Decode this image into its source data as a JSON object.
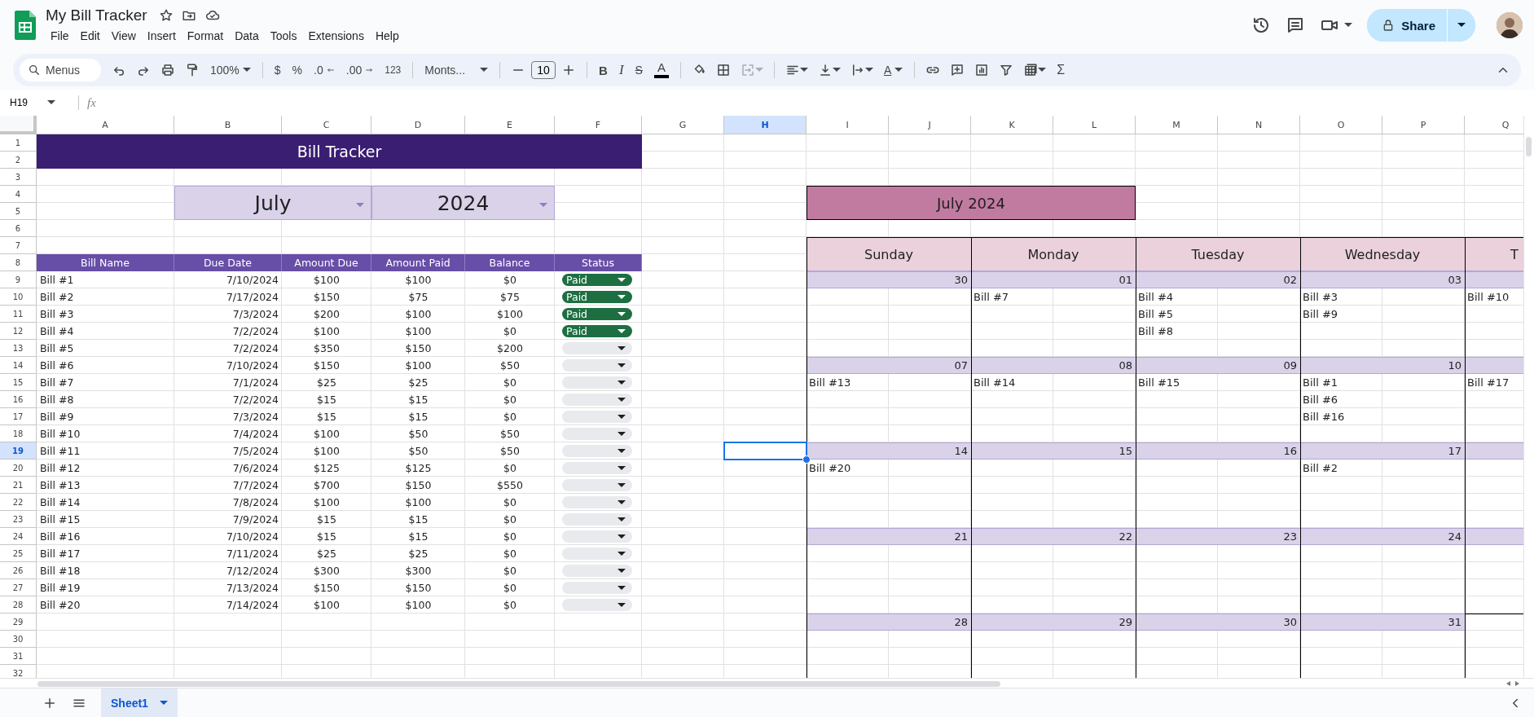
{
  "header": {
    "title": "My Bill Tracker",
    "menus": [
      "File",
      "Edit",
      "View",
      "Insert",
      "Format",
      "Data",
      "Tools",
      "Extensions",
      "Help"
    ],
    "share": "Share"
  },
  "toolbar": {
    "search_placeholder": "Menus",
    "zoom": "100%",
    "currency": "$",
    "percent": "%",
    "decrease_decimal": ".0",
    "increase_decimal": ".00",
    "number_format": "123",
    "font": "Monts...",
    "font_size": "10",
    "bold": "B",
    "italic": "I",
    "strikethrough": "S",
    "text_color": "A",
    "merge_disabled": true,
    "rotate": "A",
    "functions": "Σ"
  },
  "formula_bar": {
    "cell_ref": "H19",
    "fx": "fx"
  },
  "grid": {
    "columns": [
      {
        "label": "A",
        "selected": false
      },
      {
        "label": "B",
        "selected": false
      },
      {
        "label": "C",
        "selected": false
      },
      {
        "label": "D",
        "selected": false
      },
      {
        "label": "E",
        "selected": false
      },
      {
        "label": "F",
        "selected": false
      },
      {
        "label": "G",
        "selected": false
      },
      {
        "label": "H",
        "selected": true
      },
      {
        "label": "I",
        "selected": false
      },
      {
        "label": "J",
        "selected": false
      },
      {
        "label": "K",
        "selected": false
      },
      {
        "label": "L",
        "selected": false
      },
      {
        "label": "M",
        "selected": false
      },
      {
        "label": "N",
        "selected": false
      },
      {
        "label": "O",
        "selected": false
      },
      {
        "label": "P",
        "selected": false
      },
      {
        "label": "Q",
        "selected": false
      }
    ],
    "rows": [
      {
        "label": "1",
        "selected": false
      },
      {
        "label": "2",
        "selected": false
      },
      {
        "label": "3",
        "selected": false
      },
      {
        "label": "4",
        "selected": false
      },
      {
        "label": "5",
        "selected": false
      },
      {
        "label": "6",
        "selected": false
      },
      {
        "label": "7",
        "selected": false
      },
      {
        "label": "8",
        "selected": false
      },
      {
        "label": "9",
        "selected": false
      },
      {
        "label": "10",
        "selected": false
      },
      {
        "label": "11",
        "selected": false
      },
      {
        "label": "12",
        "selected": false
      },
      {
        "label": "13",
        "selected": false
      },
      {
        "label": "14",
        "selected": false
      },
      {
        "label": "15",
        "selected": false
      },
      {
        "label": "16",
        "selected": false
      },
      {
        "label": "17",
        "selected": false
      },
      {
        "label": "18",
        "selected": false
      },
      {
        "label": "19",
        "selected": true
      },
      {
        "label": "20",
        "selected": false
      },
      {
        "label": "21",
        "selected": false
      },
      {
        "label": "22",
        "selected": false
      },
      {
        "label": "23",
        "selected": false
      },
      {
        "label": "24",
        "selected": false
      },
      {
        "label": "25",
        "selected": false
      },
      {
        "label": "26",
        "selected": false
      },
      {
        "label": "27",
        "selected": false
      },
      {
        "label": "28",
        "selected": false
      },
      {
        "label": "29",
        "selected": false
      },
      {
        "label": "30",
        "selected": false
      },
      {
        "label": "31",
        "selected": false
      },
      {
        "label": "32",
        "selected": false
      }
    ]
  },
  "sheet": {
    "title": "Bill Tracker",
    "month": "July",
    "year": "2024",
    "table": {
      "columns": [
        "Bill Name",
        "Due Date",
        "Amount Due",
        "Amount Paid",
        "Balance",
        "Status"
      ],
      "rows": [
        {
          "cells": [
            "Bill #1",
            "7/10/2024",
            "$100",
            "$100",
            "$0"
          ],
          "status": "Paid"
        },
        {
          "cells": [
            "Bill #2",
            "7/17/2024",
            "$150",
            "$75",
            "$75"
          ],
          "status": "Paid"
        },
        {
          "cells": [
            "Bill #3",
            "7/3/2024",
            "$200",
            "$100",
            "$100"
          ],
          "status": "Paid"
        },
        {
          "cells": [
            "Bill #4",
            "7/2/2024",
            "$100",
            "$100",
            "$0"
          ],
          "status": "Paid"
        },
        {
          "cells": [
            "Bill #5",
            "7/2/2024",
            "$350",
            "$150",
            "$200"
          ]
        },
        {
          "cells": [
            "Bill #6",
            "7/10/2024",
            "$150",
            "$100",
            "$50"
          ]
        },
        {
          "cells": [
            "Bill #7",
            "7/1/2024",
            "$25",
            "$25",
            "$0"
          ]
        },
        {
          "cells": [
            "Bill #8",
            "7/2/2024",
            "$15",
            "$15",
            "$0"
          ]
        },
        {
          "cells": [
            "Bill #9",
            "7/3/2024",
            "$15",
            "$15",
            "$0"
          ]
        },
        {
          "cells": [
            "Bill #10",
            "7/4/2024",
            "$100",
            "$50",
            "$50"
          ]
        },
        {
          "cells": [
            "Bill #11",
            "7/5/2024",
            "$100",
            "$50",
            "$50"
          ]
        },
        {
          "cells": [
            "Bill #12",
            "7/6/2024",
            "$125",
            "$125",
            "$0"
          ]
        },
        {
          "cells": [
            "Bill #13",
            "7/7/2024",
            "$700",
            "$150",
            "$550"
          ]
        },
        {
          "cells": [
            "Bill #14",
            "7/8/2024",
            "$100",
            "$100",
            "$0"
          ]
        },
        {
          "cells": [
            "Bill #15",
            "7/9/2024",
            "$15",
            "$15",
            "$0"
          ]
        },
        {
          "cells": [
            "Bill #16",
            "7/10/2024",
            "$15",
            "$15",
            "$0"
          ]
        },
        {
          "cells": [
            "Bill #17",
            "7/11/2024",
            "$25",
            "$25",
            "$0"
          ]
        },
        {
          "cells": [
            "Bill #18",
            "7/12/2024",
            "$300",
            "$300",
            "$0"
          ]
        },
        {
          "cells": [
            "Bill #19",
            "7/13/2024",
            "$150",
            "$150",
            "$0"
          ]
        },
        {
          "cells": [
            "Bill #20",
            "7/14/2024",
            "$100",
            "$100",
            "$0"
          ]
        }
      ]
    }
  },
  "calendar": {
    "title": "July 2024",
    "days": [
      "Sunday",
      "Monday",
      "Tuesday",
      "Wednesday",
      "T"
    ],
    "weeks": [
      {
        "continues": true,
        "next_day_bills": [
          "Bill #10"
        ],
        "days": [
          {
            "date": "30"
          },
          {
            "date": "01",
            "bills": [
              "Bill #7"
            ]
          },
          {
            "date": "02",
            "bills": [
              "Bill #4",
              "Bill #5",
              "Bill #8"
            ]
          },
          {
            "date": "03",
            "bills": [
              "Bill #3",
              "Bill #9"
            ]
          }
        ]
      },
      {
        "continues": true,
        "next_day_bills": [
          "Bill #17"
        ],
        "days": [
          {
            "date": "07",
            "bills": [
              "Bill #13"
            ]
          },
          {
            "date": "08",
            "bills": [
              "Bill #14"
            ]
          },
          {
            "date": "09",
            "bills": [
              "Bill #15"
            ]
          },
          {
            "date": "10",
            "bills": [
              "Bill #1",
              "Bill #6",
              "Bill #16"
            ]
          }
        ]
      },
      {
        "continues": true,
        "days": [
          {
            "date": "14",
            "bills": [
              "Bill #20"
            ]
          },
          {
            "date": "15"
          },
          {
            "date": "16"
          },
          {
            "date": "17",
            "bills": [
              "Bill #2"
            ]
          }
        ]
      },
      {
        "continues": true,
        "days": [
          {
            "date": "21"
          },
          {
            "date": "22"
          },
          {
            "date": "23"
          },
          {
            "date": "24"
          }
        ]
      },
      {
        "continues": false,
        "days": [
          {
            "date": "28"
          },
          {
            "date": "29"
          },
          {
            "date": "30"
          },
          {
            "date": "31"
          }
        ]
      }
    ]
  },
  "sheet_tabs": [
    {
      "label": "Sheet1",
      "selected": true
    }
  ]
}
